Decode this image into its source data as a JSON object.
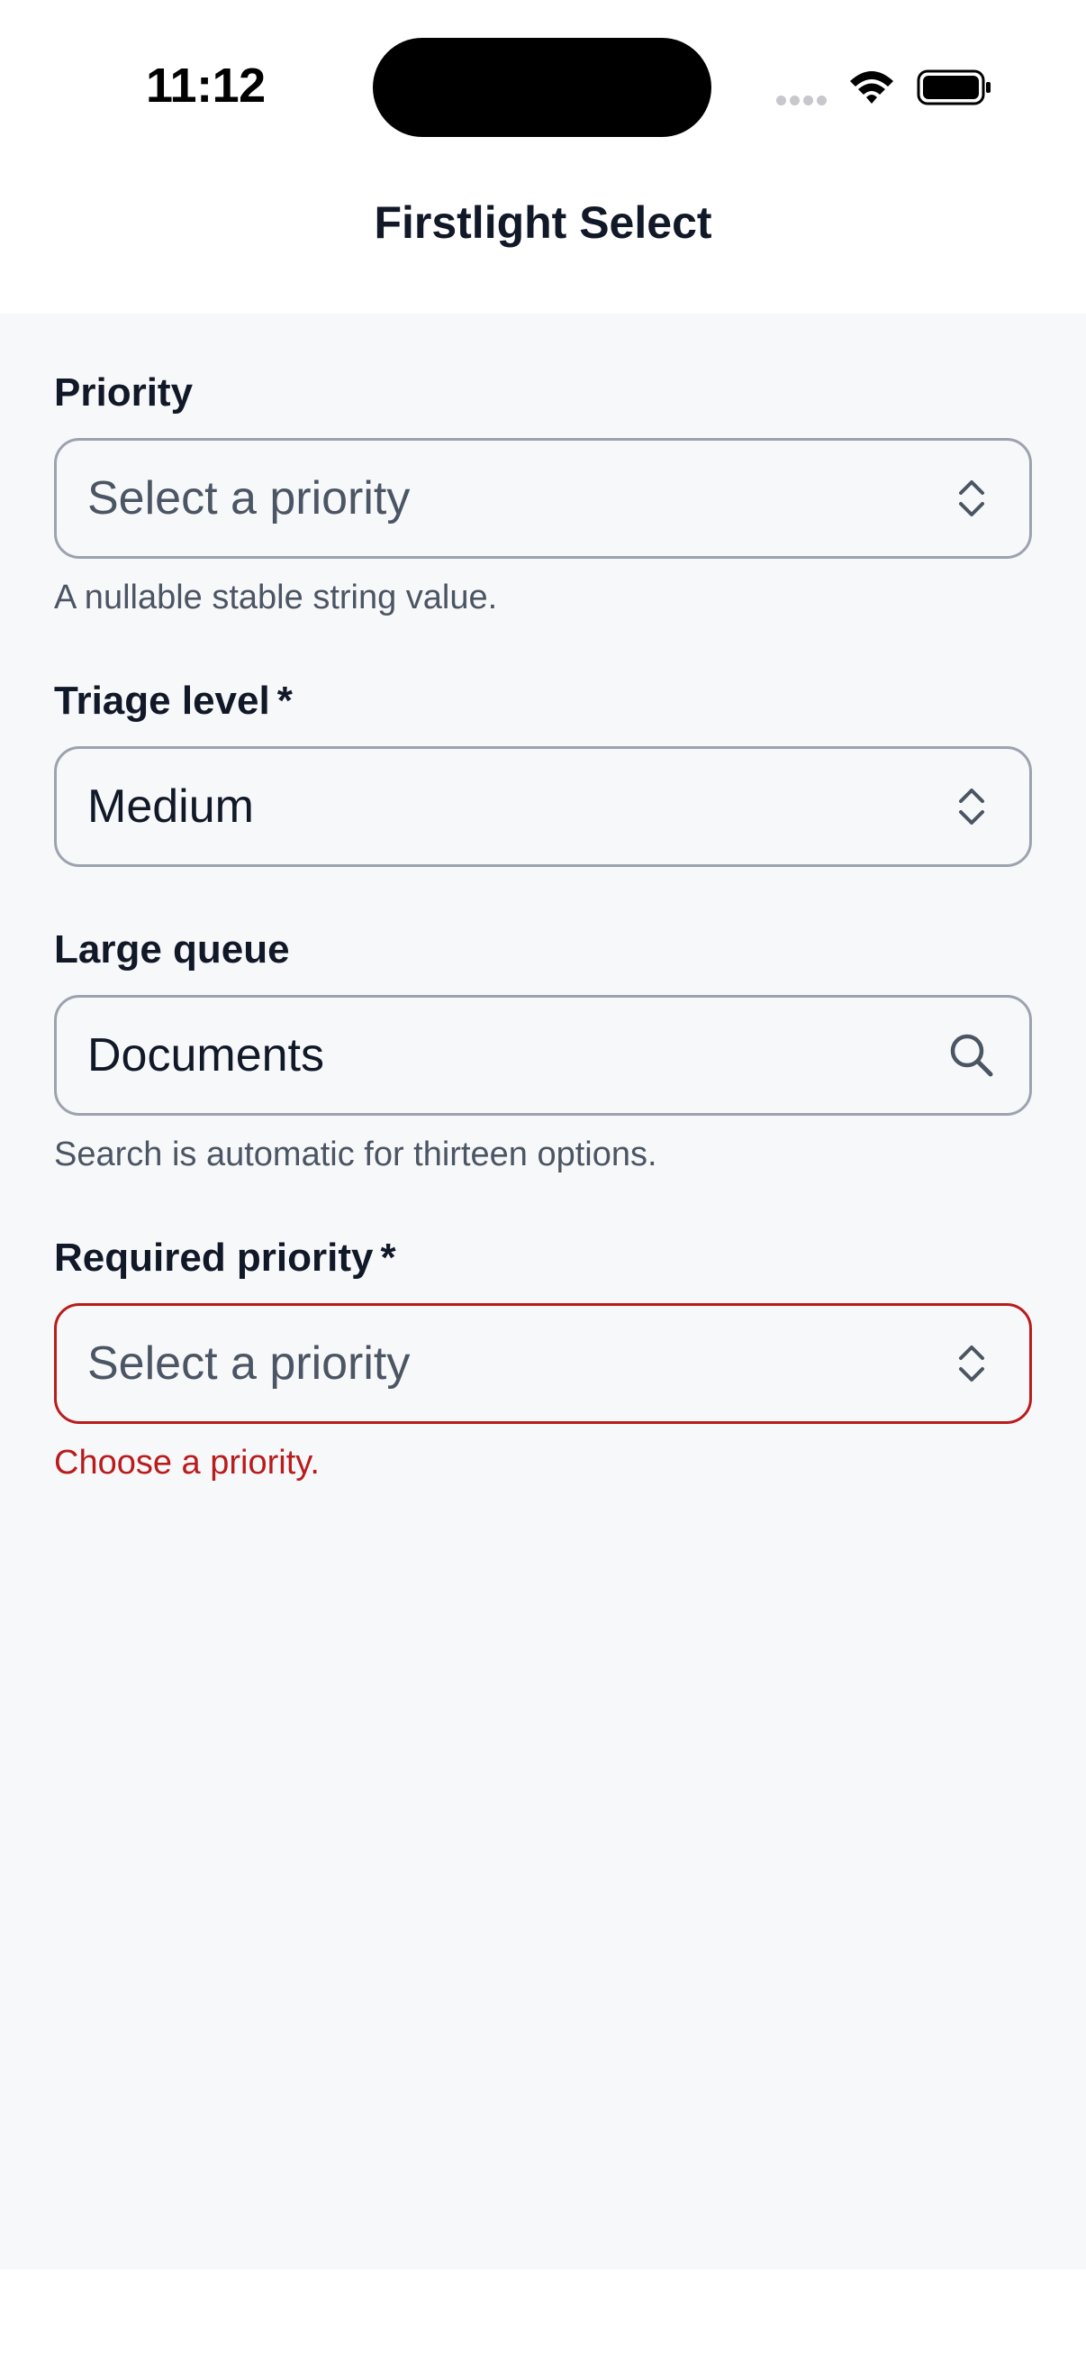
{
  "status_bar": {
    "time": "11:12"
  },
  "nav": {
    "title": "Firstlight Select"
  },
  "fields": [
    {
      "label": "Priority",
      "required": false,
      "value": "Select a priority",
      "is_placeholder": true,
      "icon": "chevron-up-down-icon",
      "hint": "A nullable stable string value."
    },
    {
      "label": "Triage level",
      "required": true,
      "required_mark": "*",
      "value": "Medium",
      "is_placeholder": false,
      "icon": "chevron-up-down-icon"
    },
    {
      "label": "Large queue",
      "required": false,
      "value": "Documents",
      "is_placeholder": false,
      "icon": "search-icon",
      "hint": "Search is automatic for thirteen options."
    },
    {
      "label": "Required priority",
      "required": true,
      "required_mark": "*",
      "value": "Select a priority",
      "is_placeholder": true,
      "icon": "chevron-up-down-icon",
      "error": "Choose a priority."
    }
  ],
  "colors": {
    "error": "#b91c1c",
    "border": "#9ca3af",
    "background": "#f7f8fa",
    "text": "#111827",
    "muted": "#4b5563"
  }
}
